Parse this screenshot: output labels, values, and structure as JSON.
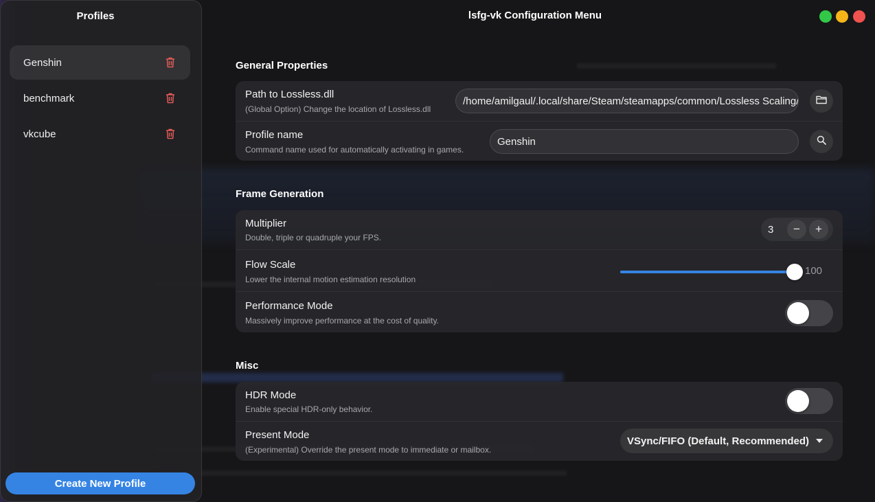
{
  "window": {
    "title": "lsfg-vk Configuration Menu",
    "buttons": [
      "maximize",
      "minimize",
      "close"
    ]
  },
  "sidebar": {
    "title": "Profiles",
    "profiles": [
      {
        "name": "Genshin",
        "active": true
      },
      {
        "name": "benchmark",
        "active": false
      },
      {
        "name": "vkcube",
        "active": false
      }
    ],
    "create_label": "Create New Profile"
  },
  "general": {
    "title": "General Properties",
    "path": {
      "title": "Path to Lossless.dll",
      "subtitle": "(Global Option) Change the location of Lossless.dll",
      "value": "/home/amilgaul/.local/share/Steam/steamapps/common/Lossless Scaling/Lossless.dll",
      "icon": "folder-icon"
    },
    "profile_name": {
      "title": "Profile name",
      "subtitle": "Command name used for automatically activating in games.",
      "value": "Genshin",
      "icon": "search-icon"
    }
  },
  "framegen": {
    "title": "Frame Generation",
    "multiplier": {
      "title": "Multiplier",
      "subtitle": "Double, triple or quadruple your FPS.",
      "value": "3",
      "minus": "−",
      "plus": "+"
    },
    "flow_scale": {
      "title": "Flow Scale",
      "subtitle": "Lower the internal motion estimation resolution",
      "value": "100",
      "fraction": 1.0
    },
    "performance": {
      "title": "Performance Mode",
      "subtitle": "Massively improve performance at the cost of quality.",
      "enabled": false
    }
  },
  "misc": {
    "title": "Misc",
    "hdr": {
      "title": "HDR Mode",
      "subtitle": "Enable special HDR-only behavior.",
      "enabled": false
    },
    "present": {
      "title": "Present Mode",
      "subtitle": "(Experimental) Override the present mode to immediate or mailbox.",
      "value": "VSync/FIFO (Default, Recommended)"
    }
  },
  "colors": {
    "accent": "#3584e4",
    "destructive": "#e05a56",
    "close": "#f0524f",
    "minimize": "#f5b519",
    "maximize": "#33c748"
  }
}
